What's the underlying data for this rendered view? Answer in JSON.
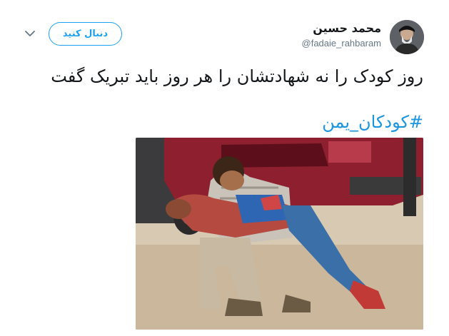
{
  "tweet": {
    "author": {
      "display_name": "محمد حسین",
      "handle": "@fadaie_rahbaram"
    },
    "follow_label": "دنبال کنید",
    "text": "روز کودک را نه شهادتشان را هر روز باید تبریک گفت",
    "hashtag": "#کودکان_یمن",
    "link_color": "#1b95e0",
    "icons": [
      "chevron-down-icon",
      "avatar",
      "photo"
    ]
  }
}
